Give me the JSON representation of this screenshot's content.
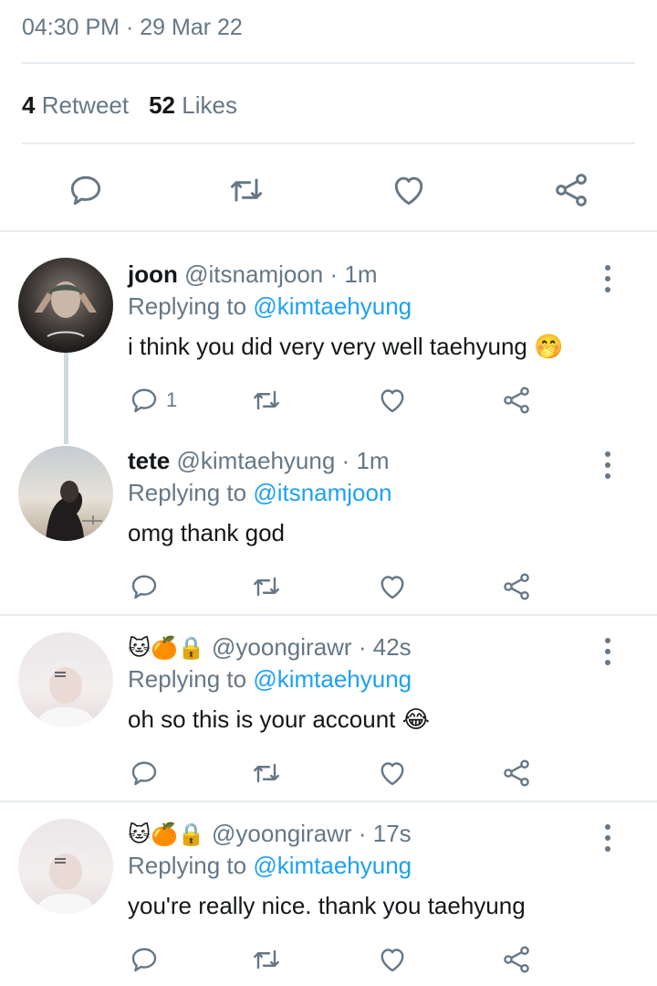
{
  "tweet": {
    "time": "04:30 PM",
    "date": "29 Mar 22",
    "retweet_count": "4",
    "retweet_label": "Retweet",
    "likes_count": "52",
    "likes_label": "Likes"
  },
  "icons": {
    "reply": "reply-icon",
    "retweet": "retweet-icon",
    "like": "heart-icon",
    "share": "share-icon",
    "more": "more-vertical-icon"
  },
  "colors": {
    "mention": "#1da1f2",
    "secondary_text": "#657786",
    "divider": "#e6ecf0"
  },
  "replies": [
    {
      "name": "joon",
      "handle": "@itsnamjoon",
      "time": "1m",
      "replying_label": "Replying to",
      "replying_to": "@kimtaehyung",
      "text": "i think you did very very well taehyung",
      "emoji": "🤭",
      "reply_count": "1"
    },
    {
      "name": "tete",
      "handle": "@kimtaehyung",
      "time": "1m",
      "replying_label": "Replying to",
      "replying_to": "@itsnamjoon",
      "text": "omg thank god",
      "emoji": "",
      "reply_count": ""
    },
    {
      "name": "🐱🍊🔒",
      "handle": "@yoongirawr",
      "time": "42s",
      "replying_label": "Replying to",
      "replying_to": "@kimtaehyung",
      "text": "oh so this is your account",
      "emoji": "😂",
      "reply_count": ""
    },
    {
      "name": "🐱🍊🔒",
      "handle": "@yoongirawr",
      "time": "17s",
      "replying_label": "Replying to",
      "replying_to": "@kimtaehyung",
      "text": "you're really nice. thank you taehyung",
      "emoji": "",
      "reply_count": ""
    }
  ]
}
